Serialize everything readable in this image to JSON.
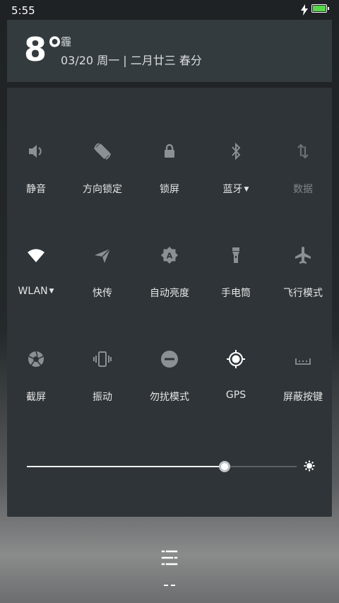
{
  "status": {
    "time": "5:55",
    "battery_level": 1.0
  },
  "weather": {
    "temperature": "8°",
    "condition": "霾",
    "date": "03/20 周一 | 二月廿三 春分"
  },
  "tiles": [
    {
      "label": "静音",
      "icon": "speaker-icon",
      "active": false
    },
    {
      "label": "方向锁定",
      "icon": "rotation-lock-icon",
      "active": false
    },
    {
      "label": "锁屏",
      "icon": "lock-icon",
      "active": false
    },
    {
      "label": "蓝牙",
      "icon": "bluetooth-icon",
      "active": false,
      "dropdown": true
    },
    {
      "label": "数据",
      "icon": "mobile-data-icon",
      "active": false,
      "disabled": true
    },
    {
      "label": "WLAN",
      "icon": "wifi-icon",
      "active": true,
      "dropdown": true
    },
    {
      "label": "快传",
      "icon": "send-icon",
      "active": false
    },
    {
      "label": "自动亮度",
      "icon": "auto-brightness-icon",
      "active": false
    },
    {
      "label": "手电筒",
      "icon": "flashlight-icon",
      "active": false
    },
    {
      "label": "飞行模式",
      "icon": "airplane-icon",
      "active": false
    },
    {
      "label": "截屏",
      "icon": "screenshot-icon",
      "active": false
    },
    {
      "label": "振动",
      "icon": "vibrate-icon",
      "active": false
    },
    {
      "label": "勿扰模式",
      "icon": "do-not-disturb-icon",
      "active": false
    },
    {
      "label": "GPS",
      "icon": "gps-icon",
      "active": true
    },
    {
      "label": "屏蔽按键",
      "icon": "block-keys-icon",
      "active": false
    }
  ],
  "brightness": {
    "level": 0.733
  },
  "colors": {
    "accent_battery": "#56d64a",
    "panel": "#2e3438",
    "icon_inactive": "#8a9094",
    "icon_active": "#ffffff"
  }
}
